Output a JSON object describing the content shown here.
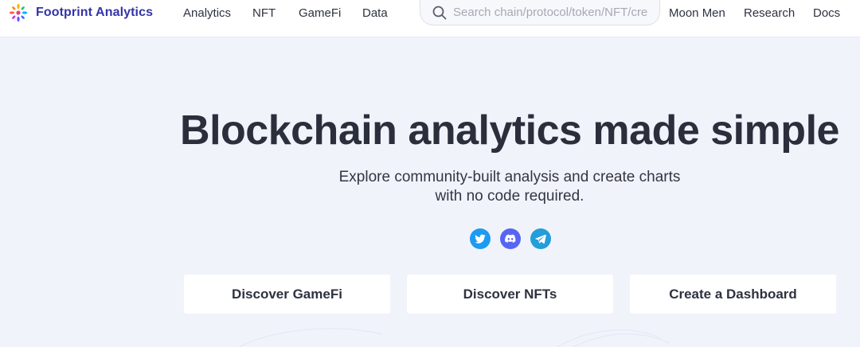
{
  "brand": {
    "name": "Footprint Analytics"
  },
  "nav": {
    "left": [
      "Analytics",
      "NFT",
      "GameFi",
      "Data"
    ],
    "right": [
      "Moon Men",
      "Research",
      "Docs"
    ]
  },
  "search": {
    "placeholder": "Search chain/protocol/token/NFT/creator"
  },
  "hero": {
    "title": "Blockchain analytics made simple",
    "subtitle_line1": "Explore community-built analysis and create charts",
    "subtitle_line2": "with no code required."
  },
  "socials": [
    {
      "icon": "twitter-icon",
      "color": "#1d9bf0"
    },
    {
      "icon": "discord-icon",
      "color": "#5865f2"
    },
    {
      "icon": "telegram-icon",
      "color": "#229ed9"
    }
  ],
  "cards": [
    "Discover GameFi",
    "Discover NFTs",
    "Create a Dashboard"
  ],
  "colors": {
    "brand": "#3434a8",
    "background": "#f1f3fb",
    "text": "#2b2f3c"
  }
}
